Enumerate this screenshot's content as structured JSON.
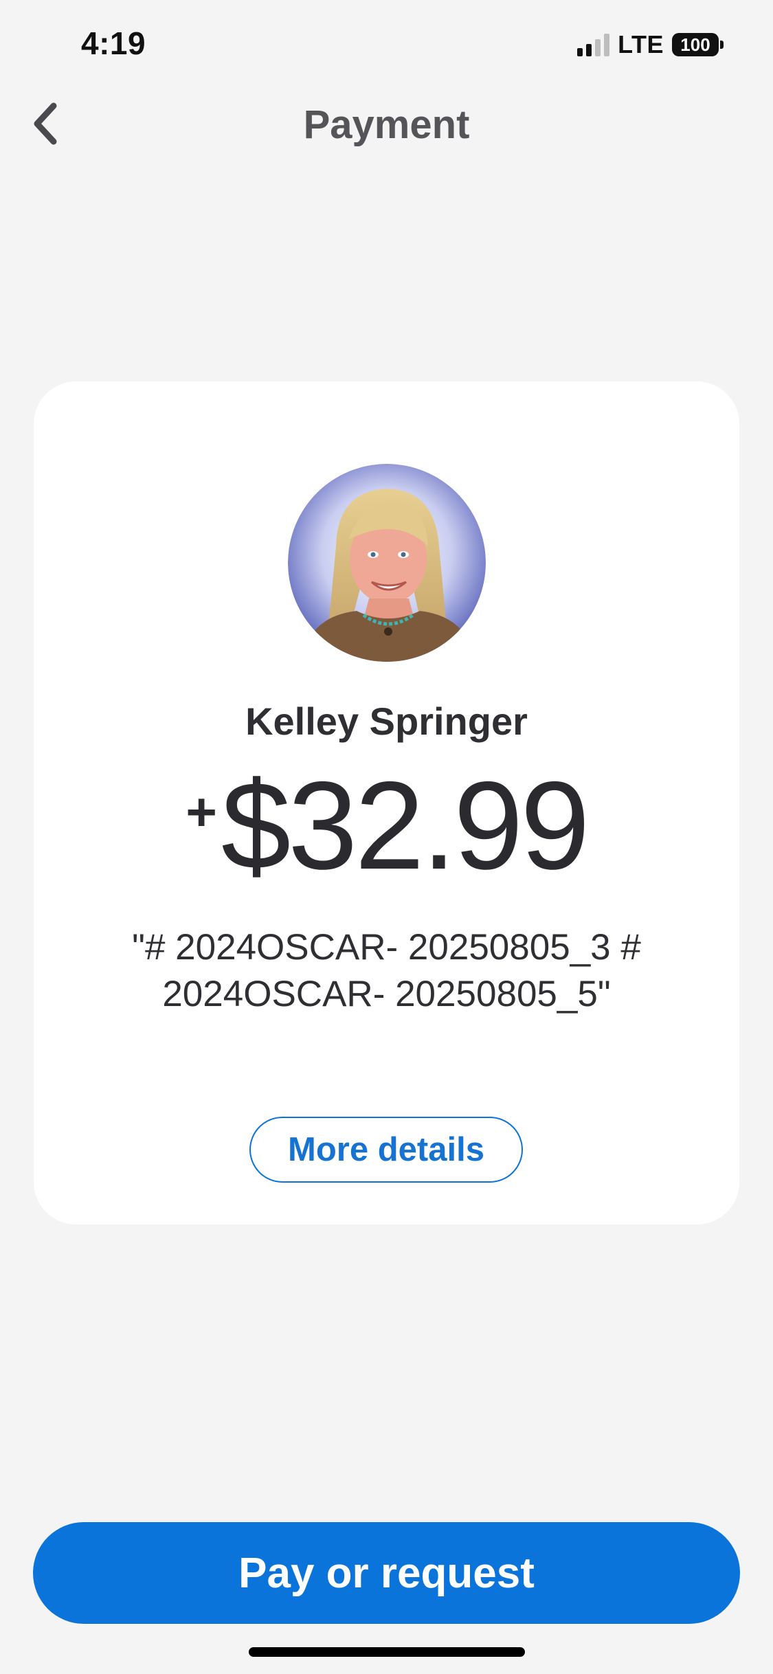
{
  "status_bar": {
    "time": "4:19",
    "network": "LTE",
    "battery": "100"
  },
  "header": {
    "title": "Payment",
    "back_icon": "chevron-left-icon"
  },
  "card": {
    "payer_name": "Kelley Springer",
    "amount_sign": "+",
    "amount": "$32.99",
    "note": "\"# 2024OSCAR- 20250805_3 # 2024OSCAR- 20250805_5\"",
    "more_details_label": "More details"
  },
  "footer": {
    "pay_request_label": "Pay or request"
  },
  "colors": {
    "accent": "#0a74da",
    "background": "#f4f4f4",
    "card": "#ffffff",
    "text_primary": "#2b2b2f"
  }
}
